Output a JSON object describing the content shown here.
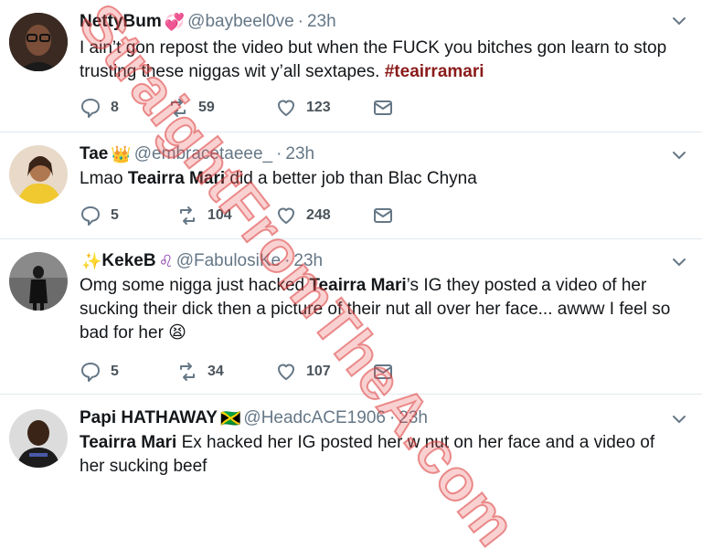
{
  "tweets": [
    {
      "name": "NettyBum",
      "emoji": "💞",
      "handle": "@baybeel0ve",
      "time": "23h",
      "text_plain": "I ain’t gon repost the video but when the FUCK you bitches gon learn to stop trusting these niggas wit y’all sextapes. ",
      "hashtag": "#teairramari",
      "replies": "8",
      "retweets": "59",
      "likes": "123"
    },
    {
      "name": "Tae",
      "emoji": "👑",
      "handle": "@embracetaeee_",
      "time": "23h",
      "text_pre": "Lmao ",
      "text_bold": "Teairra Mari",
      "text_post": " did a better job than Blac Chyna",
      "replies": "5",
      "retweets": "104",
      "likes": "248"
    },
    {
      "name_prefix": "✨",
      "name": "KekeB",
      "emoji": "♌",
      "handle": "@FabulosiKe",
      "time": "23h",
      "text_pre": "Omg some nigga just hacked ",
      "text_bold": "Teairra Mari",
      "text_post": "’s IG they posted a video of her sucking their dick then a picture of their nut all over her face... awww I feel so bad for her ",
      "text_emoji": "😫",
      "replies": "5",
      "retweets": "34",
      "likes": "107"
    },
    {
      "name": "Papi HATHAWAY",
      "emoji": "🇯🇲",
      "handle": "@HeadcACE1906",
      "time": "23h",
      "text_bold": "Teairra Mari",
      "text_post": " Ex hacked her IG posted her w nut on her face and a video of her sucking beef"
    }
  ],
  "watermark": "StraightFromTheA.com",
  "colors": {
    "hashtag": "#8b1a1a",
    "meta": "#657786",
    "divider": "#e1e8ed"
  }
}
